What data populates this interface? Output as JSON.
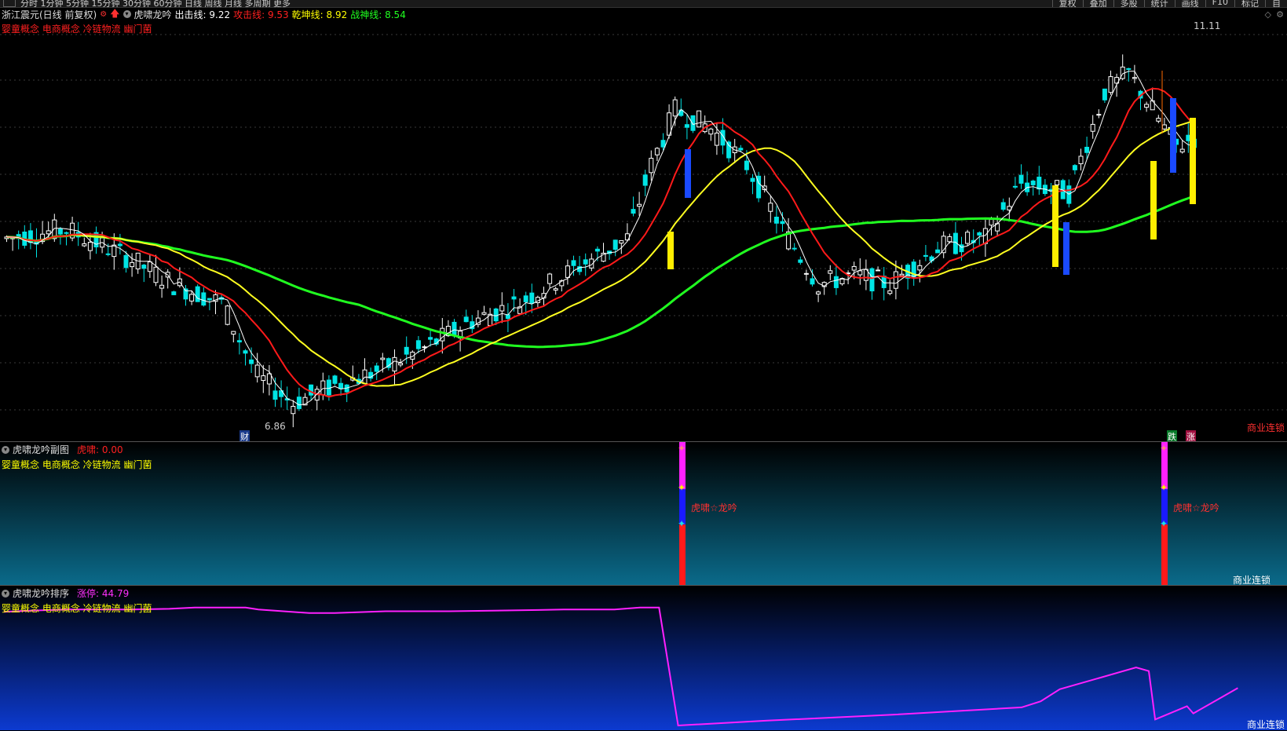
{
  "topbar": {
    "periods": "分时  1分钟  5分钟  15分钟  30分钟  60分钟  日线  周线  月线  多周期  更多",
    "tools": [
      "复权",
      "叠加",
      "多股",
      "统计",
      "画线",
      "F10",
      "标记",
      "自"
    ]
  },
  "main": {
    "stock": "浙江震元(日线 前复权)",
    "indicator": "虎啸龙吟",
    "lines": [
      {
        "label": "出击线: 9.22",
        "color": "#ffffff"
      },
      {
        "label": "攻击线: 9.53",
        "color": "#ff2020"
      },
      {
        "label": "乾坤线: 8.92",
        "color": "#ffff00"
      },
      {
        "label": "战神线: 8.54",
        "color": "#20ff20"
      }
    ],
    "concepts": "婴童概念 电商概念 冷链物流 幽门菌",
    "high_label": "11.11",
    "low_label": "6.86",
    "cai_label": "财",
    "die_label": "跌",
    "zhang_label": "涨",
    "lock": "商业连锁"
  },
  "sub1": {
    "title": "虎啸龙吟副图",
    "value": "虎啸: 0.00",
    "concepts": "婴童概念 电商概念 冷链物流 幽门菌",
    "signal_label": "虎啸☆龙吟",
    "lock": "商业连锁"
  },
  "sub2": {
    "title": "虎啸龙吟排序",
    "value": "涨停: 44.79",
    "concepts": "婴童概念 电商概念 冷链物流 幽门菌",
    "lock": "商业连锁"
  },
  "chart_data": {
    "type": "line",
    "price_high": 11.11,
    "price_low": 6.86,
    "zhangting_series": [
      {
        "x": 0.0,
        "v": 0.94
      },
      {
        "x": 0.02,
        "v": 0.95
      },
      {
        "x": 0.05,
        "v": 0.96
      },
      {
        "x": 0.1,
        "v": 0.96
      },
      {
        "x": 0.13,
        "v": 0.965
      },
      {
        "x": 0.15,
        "v": 0.975
      },
      {
        "x": 0.19,
        "v": 0.975
      },
      {
        "x": 0.2,
        "v": 0.96
      },
      {
        "x": 0.24,
        "v": 0.93
      },
      {
        "x": 0.26,
        "v": 0.93
      },
      {
        "x": 0.3,
        "v": 0.945
      },
      {
        "x": 0.35,
        "v": 0.945
      },
      {
        "x": 0.42,
        "v": 0.955
      },
      {
        "x": 0.44,
        "v": 0.96
      },
      {
        "x": 0.48,
        "v": 0.96
      },
      {
        "x": 0.5,
        "v": 0.975
      },
      {
        "x": 0.515,
        "v": 0.975
      },
      {
        "x": 0.53,
        "v": 0.0
      },
      {
        "x": 0.6,
        "v": 0.04
      },
      {
        "x": 0.7,
        "v": 0.09
      },
      {
        "x": 0.8,
        "v": 0.15
      },
      {
        "x": 0.815,
        "v": 0.2
      },
      {
        "x": 0.83,
        "v": 0.3
      },
      {
        "x": 0.89,
        "v": 0.48
      },
      {
        "x": 0.9,
        "v": 0.45
      },
      {
        "x": 0.905,
        "v": 0.05
      },
      {
        "x": 0.93,
        "v": 0.16
      },
      {
        "x": 0.935,
        "v": 0.1
      },
      {
        "x": 0.97,
        "v": 0.31
      }
    ]
  }
}
